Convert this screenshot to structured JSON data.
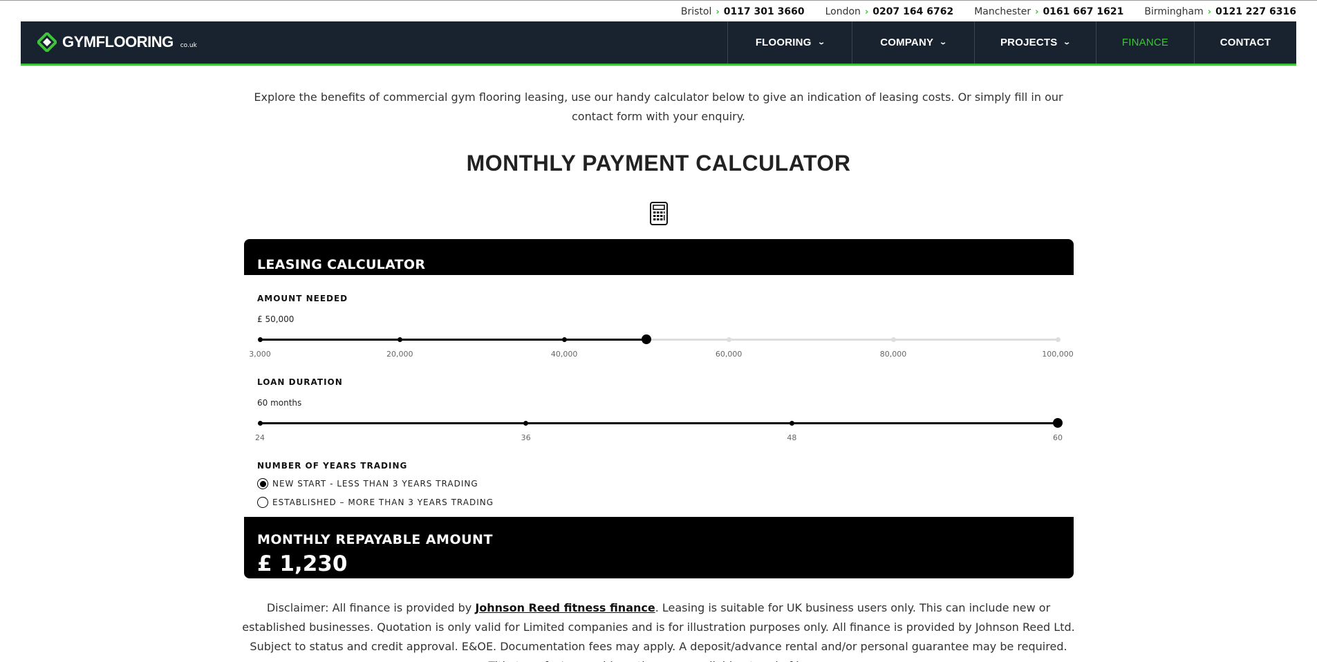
{
  "topbar": {
    "contacts": [
      {
        "city": "Bristol",
        "phone": "0117 301 3660"
      },
      {
        "city": "London",
        "phone": "0207 164 6762"
      },
      {
        "city": "Manchester",
        "phone": "0161 667 1621"
      },
      {
        "city": "Birmingham",
        "phone": "0121 227 6316"
      }
    ]
  },
  "nav": {
    "logo_gym": "GYM",
    "logo_flooring": "FLOORING",
    "logo_suffix": "co.uk",
    "items": [
      {
        "label": "FLOORING",
        "dropdown": true
      },
      {
        "label": "COMPANY",
        "dropdown": true
      },
      {
        "label": "PROJECTS",
        "dropdown": true
      },
      {
        "label": "FINANCE",
        "dropdown": false,
        "active": true
      },
      {
        "label": "CONTACT",
        "dropdown": false
      }
    ]
  },
  "intro": "Explore the benefits of commercial gym flooring leasing, use our handy calculator below to give an indication of leasing costs. Or simply fill in our contact form with your enquiry.",
  "heading": "MONTHLY PAYMENT CALCULATOR",
  "calculator": {
    "title": "LEASING CALCULATOR",
    "amount": {
      "label": "AMOUNT NEEDED",
      "value_text": "£ 50,000",
      "min": 3000,
      "max": 100000,
      "value": 50000,
      "ticks": [
        3000,
        20000,
        40000,
        60000,
        80000,
        100000
      ],
      "tick_labels": [
        "3,000",
        "20,000",
        "40,000",
        "60,000",
        "80,000",
        "100,000"
      ]
    },
    "duration": {
      "label": "LOAN DURATION",
      "value_text": "60 months",
      "min": 24,
      "max": 60,
      "value": 60,
      "ticks": [
        24,
        36,
        48,
        60
      ],
      "tick_labels": [
        "24",
        "36",
        "48",
        "60"
      ]
    },
    "trading": {
      "label": "NUMBER OF YEARS TRADING",
      "options": [
        {
          "label": "NEW START - LESS THAN 3 YEARS TRADING",
          "selected": true
        },
        {
          "label": "ESTABLISHED – MORE THAN 3 YEARS TRADING",
          "selected": false
        }
      ]
    },
    "result_label": "MONTHLY REPAYABLE AMOUNT",
    "result_value": "£ 1,230"
  },
  "disclaimer": {
    "prefix": "Disclaimer: All finance is provided by ",
    "link": "Johnson Reed fitness finance",
    "suffix": ". Leasing is suitable for UK business users only. This can include new or established businesses. Quotation is only valid for Limited companies and is for illustration purposes only. All finance is provided by Johnson Reed Ltd. Subject to status and credit approval. E&OE. Documentation fees may apply. A deposit/advance rental and/or personal guarantee may be required. Title transfer/ownership options are available at end of lease."
  },
  "colors": {
    "accent": "#3fc33a",
    "nav_bg": "#18232f",
    "card_bg": "#000000"
  }
}
